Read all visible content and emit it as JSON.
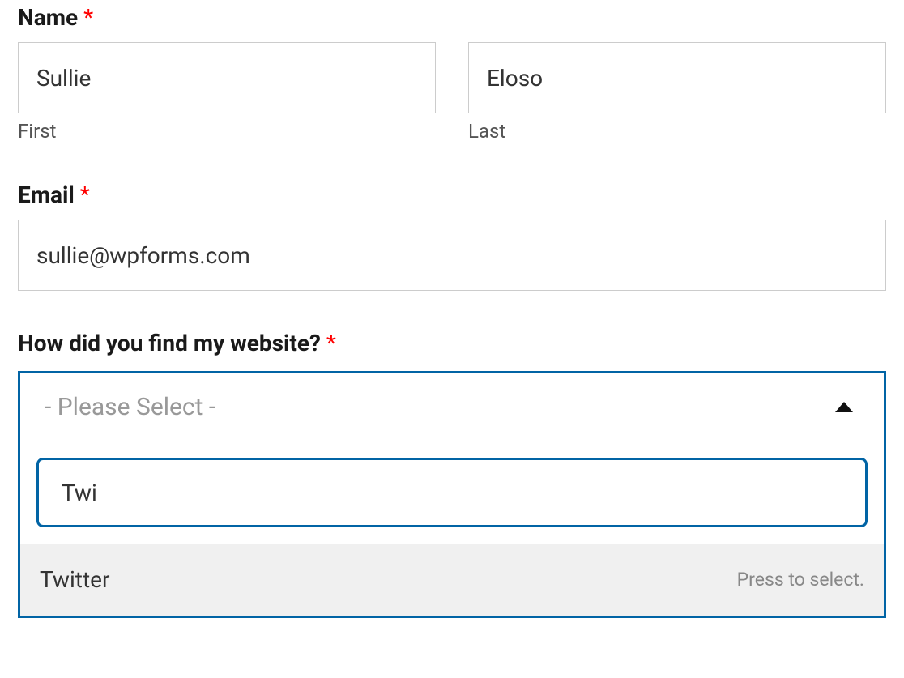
{
  "name": {
    "label": "Name",
    "required_marker": "*",
    "first_value": "Sullie",
    "first_sublabel": "First",
    "last_value": "Eloso",
    "last_sublabel": "Last"
  },
  "email": {
    "label": "Email",
    "required_marker": "*",
    "value": "sullie@wpforms.com"
  },
  "source": {
    "label": "How did you find my website?",
    "required_marker": "*",
    "placeholder": "- Please Select -",
    "search_value": "Twi",
    "option_label": "Twitter",
    "option_hint": "Press to select."
  }
}
